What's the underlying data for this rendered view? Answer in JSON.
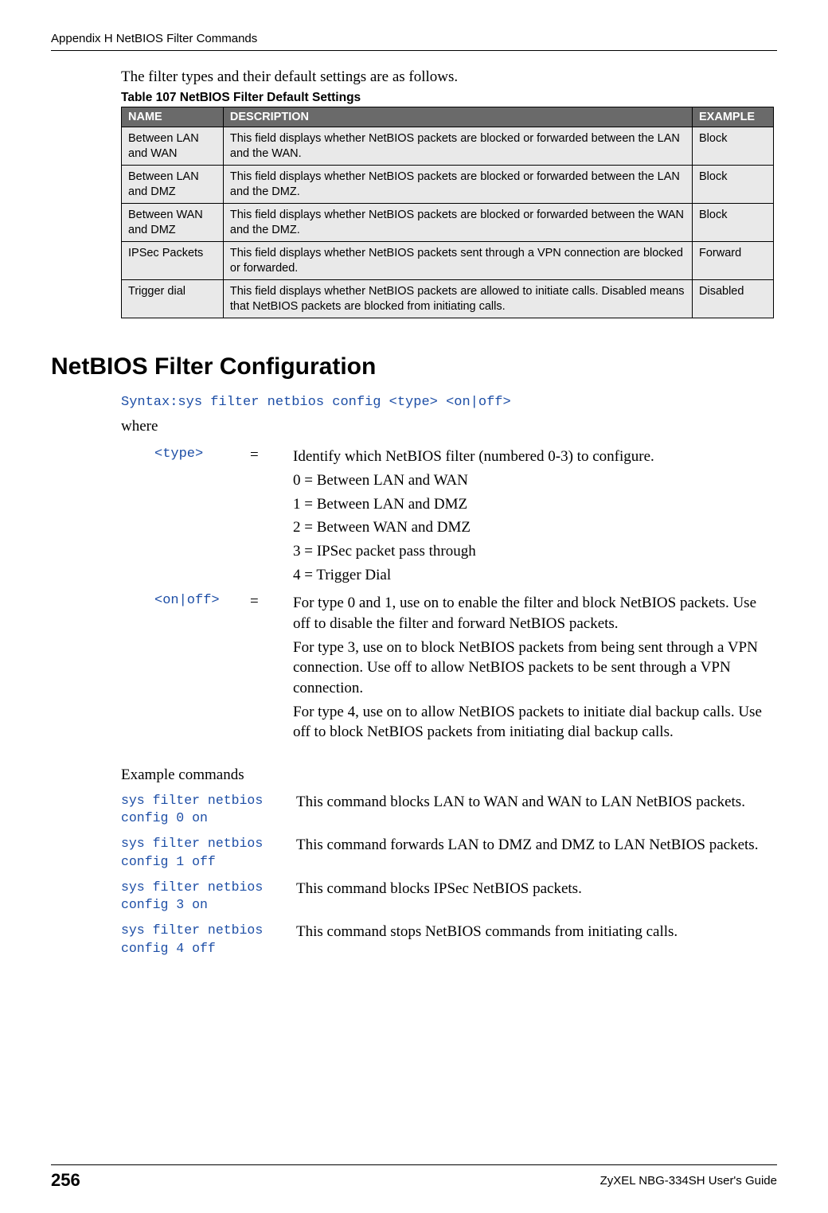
{
  "header": {
    "running_head": "Appendix H NetBIOS Filter Commands"
  },
  "intro": "The filter types and their default settings are as follows.",
  "table": {
    "caption": "Table 107   NetBIOS Filter Default Settings",
    "headers": {
      "name": "NAME",
      "description": "DESCRIPTION",
      "example": "EXAMPLE"
    },
    "rows": [
      {
        "name": "Between LAN and WAN",
        "description": "This field displays whether NetBIOS packets are blocked or forwarded between the LAN and the WAN.",
        "example": "Block"
      },
      {
        "name": "Between LAN and DMZ",
        "description": "This field displays whether NetBIOS packets are blocked or forwarded between the LAN and the DMZ.",
        "example": "Block"
      },
      {
        "name": "Between WAN and DMZ",
        "description": "This field displays whether NetBIOS packets are blocked or forwarded between the WAN and the DMZ.",
        "example": "Block"
      },
      {
        "name": "IPSec Packets",
        "description": "This field displays whether NetBIOS packets sent through a VPN connection are blocked or forwarded.",
        "example": "Forward"
      },
      {
        "name": "Trigger dial",
        "description": "This field displays whether NetBIOS packets are allowed to initiate calls. Disabled means that NetBIOS packets are blocked from initiating calls.",
        "example": "Disabled"
      }
    ]
  },
  "section": {
    "title": "NetBIOS Filter Configuration",
    "syntax": "Syntax:sys filter netbios config <type> <on|off>",
    "where": "where",
    "params": {
      "type": {
        "key": "<type>",
        "eq": "=",
        "lines": [
          "Identify which NetBIOS filter (numbered 0-3) to configure.",
          "0 = Between LAN and WAN",
          "1 = Between LAN and DMZ",
          "2 = Between WAN and DMZ",
          "3 = IPSec packet pass through",
          "4 = Trigger Dial"
        ]
      },
      "onoff": {
        "key": "<on|off>",
        "eq": "=",
        "p1": "For type 0 and 1, use on to enable the filter and block NetBIOS packets. Use off to disable the filter and forward NetBIOS packets.",
        "p2": "For type 3, use on to block NetBIOS packets from being sent through a VPN connection. Use off to allow NetBIOS packets to be sent through a VPN connection.",
        "p3": "For type 4, use on to allow NetBIOS packets to initiate dial backup calls. Use off to block NetBIOS packets from initiating dial backup calls."
      }
    },
    "examples_head": "Example commands",
    "examples": [
      {
        "cmd": "sys filter netbios config 0 on",
        "desc": "This command blocks LAN to WAN and WAN to LAN NetBIOS packets."
      },
      {
        "cmd": "sys filter netbios config 1 off",
        "desc": "This command forwards LAN to DMZ and DMZ to LAN NetBIOS packets."
      },
      {
        "cmd": "sys filter netbios config 3 on",
        "desc": "This command blocks IPSec NetBIOS packets."
      },
      {
        "cmd": "sys filter netbios config 4 off",
        "desc": "This command stops NetBIOS commands from initiating calls."
      }
    ]
  },
  "footer": {
    "page": "256",
    "guide": "ZyXEL NBG-334SH User's Guide"
  }
}
